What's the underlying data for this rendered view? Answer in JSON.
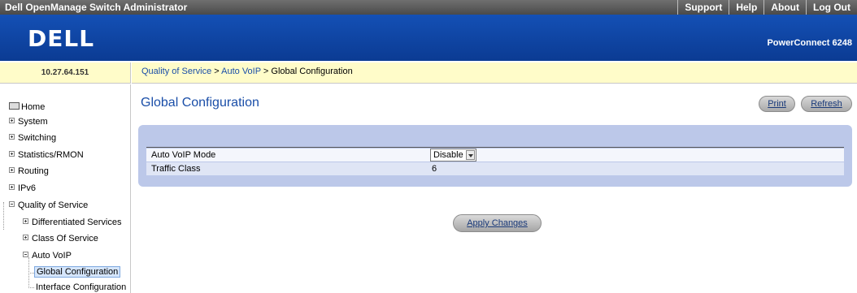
{
  "header": {
    "app_title": "Dell OpenManage Switch Administrator",
    "links": [
      "Support",
      "Help",
      "About",
      "Log Out"
    ],
    "logo_text": "DELL",
    "product": "PowerConnect 6248"
  },
  "ip_address": "10.27.64.151",
  "breadcrumb": {
    "link1": "Quality of Service",
    "sep1": " > ",
    "link2": "Auto VoIP",
    "sep2": " > ",
    "current": "Global Configuration"
  },
  "sidebar": {
    "items": [
      {
        "label": "Home"
      },
      {
        "label": "System"
      },
      {
        "label": "Switching"
      },
      {
        "label": "Statistics/RMON"
      },
      {
        "label": "Routing"
      },
      {
        "label": "IPv6"
      },
      {
        "label": "Quality of Service"
      },
      {
        "label": "Differentiated Services"
      },
      {
        "label": "Class Of Service"
      },
      {
        "label": "Auto VoIP"
      },
      {
        "label": "Global Configuration"
      },
      {
        "label": "Interface Configuration"
      }
    ]
  },
  "page": {
    "title": "Global Configuration",
    "print_label": "Print",
    "refresh_label": "Refresh",
    "apply_label": "Apply Changes"
  },
  "form": {
    "auto_voip_mode_label": "Auto VoIP Mode",
    "auto_voip_mode_value": "Disable",
    "traffic_class_label": "Traffic Class",
    "traffic_class_value": "6"
  },
  "colors": {
    "brand_blue": "#0b3e9a",
    "link_blue": "#1a4ea8",
    "panel_bg": "#bcc8e9",
    "crumb_bg": "#fffcc9"
  }
}
